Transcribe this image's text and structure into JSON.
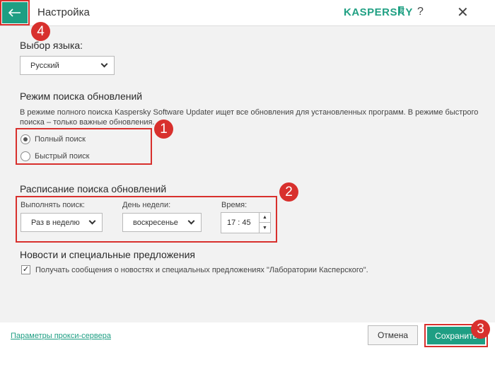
{
  "window": {
    "title": "Настройка",
    "logo_text": "KASPERSKY",
    "logo_lab": "lab",
    "help_glyph": "?",
    "close_glyph": "✕",
    "back_glyph": "⟵"
  },
  "language": {
    "label": "Выбор языка:",
    "selected": "Русский"
  },
  "search_mode": {
    "heading": "Режим поиска обновлений",
    "description_line1": "В режиме полного поиска Kaspersky Software Updater ищет все обновления для установленных программ. В режиме быстрого",
    "description_line2": "поиска – только важные обновления.",
    "options": [
      {
        "label": "Полный поиск",
        "checked": true
      },
      {
        "label": "Быстрый поиск",
        "checked": false
      }
    ]
  },
  "schedule": {
    "heading": "Расписание поиска обновлений",
    "run_label": "Выполнять поиск:",
    "run_value": "Раз в неделю",
    "day_label": "День недели:",
    "day_value": "воскресенье",
    "time_label": "Время:",
    "time_value": "17 : 45"
  },
  "news": {
    "heading": "Новости и специальные предложения",
    "checkbox_label": "Получать сообщения о новостях и специальных предложениях \"Лаборатории Касперского\".",
    "checked": true
  },
  "footer": {
    "proxy_link": "Параметры прокси-сервера",
    "cancel": "Отмена",
    "save": "Сохранить"
  },
  "annotations": [
    "1",
    "2",
    "3",
    "4"
  ],
  "colors": {
    "accent": "#1e9e83",
    "highlight": "#d8302d",
    "panel": "#f2f2f2"
  }
}
